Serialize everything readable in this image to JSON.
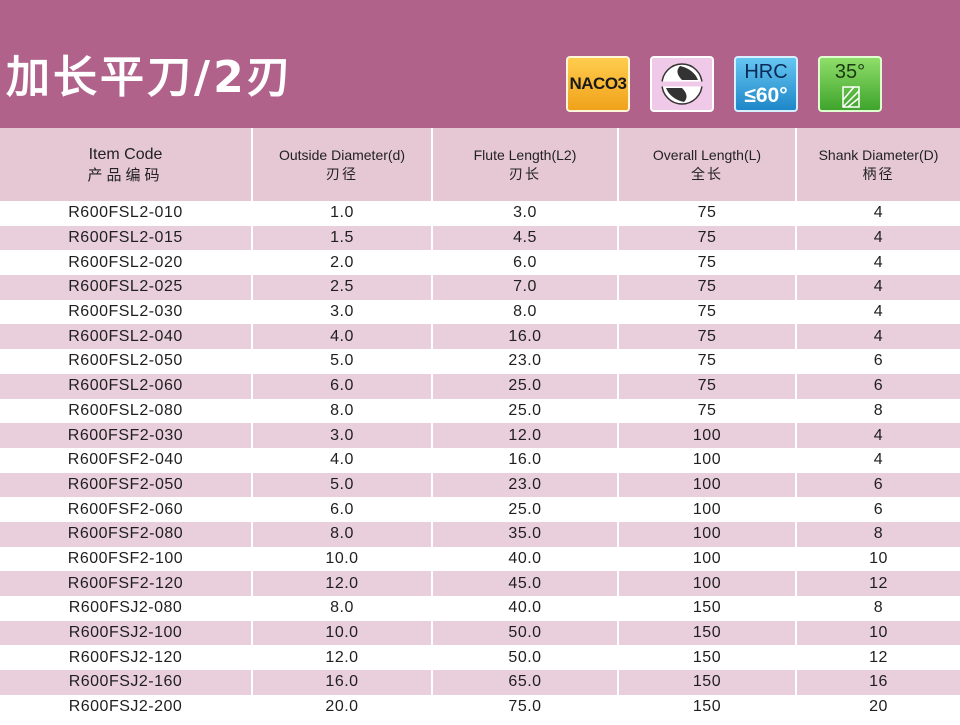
{
  "header": {
    "title": "加长平刀/2刃",
    "badges": {
      "material": "NACO3",
      "flute_icon": "two-flute-cross-section-icon",
      "hardness_line1": "HRC",
      "hardness_line2": "≤60°",
      "helix_angle": "35°",
      "helix_icon": "helix-angle-icon"
    },
    "colors": {
      "banner": "#b0628a",
      "header_row": "#e6c7d4",
      "stripe": "#e9cfdb"
    }
  },
  "table": {
    "columns": [
      {
        "en": "Item Code",
        "cn": "产品编码"
      },
      {
        "en": "Outside Diameter(d)",
        "cn": "刃径"
      },
      {
        "en": "Flute Length(L2)",
        "cn": "刃长"
      },
      {
        "en": "Overall Length(L)",
        "cn": "全长"
      },
      {
        "en": "Shank Diameter(D)",
        "cn": "柄径"
      }
    ],
    "rows": [
      [
        "R600FSL2-010",
        "1.0",
        "3.0",
        "75",
        "4"
      ],
      [
        "R600FSL2-015",
        "1.5",
        "4.5",
        "75",
        "4"
      ],
      [
        "R600FSL2-020",
        "2.0",
        "6.0",
        "75",
        "4"
      ],
      [
        "R600FSL2-025",
        "2.5",
        "7.0",
        "75",
        "4"
      ],
      [
        "R600FSL2-030",
        "3.0",
        "8.0",
        "75",
        "4"
      ],
      [
        "R600FSL2-040",
        "4.0",
        "16.0",
        "75",
        "4"
      ],
      [
        "R600FSL2-050",
        "5.0",
        "23.0",
        "75",
        "6"
      ],
      [
        "R600FSL2-060",
        "6.0",
        "25.0",
        "75",
        "6"
      ],
      [
        "R600FSL2-080",
        "8.0",
        "25.0",
        "75",
        "8"
      ],
      [
        "R600FSF2-030",
        "3.0",
        "12.0",
        "100",
        "4"
      ],
      [
        "R600FSF2-040",
        "4.0",
        "16.0",
        "100",
        "4"
      ],
      [
        "R600FSF2-050",
        "5.0",
        "23.0",
        "100",
        "6"
      ],
      [
        "R600FSF2-060",
        "6.0",
        "25.0",
        "100",
        "6"
      ],
      [
        "R600FSF2-080",
        "8.0",
        "35.0",
        "100",
        "8"
      ],
      [
        "R600FSF2-100",
        "10.0",
        "40.0",
        "100",
        "10"
      ],
      [
        "R600FSF2-120",
        "12.0",
        "45.0",
        "100",
        "12"
      ],
      [
        "R600FSJ2-080",
        "8.0",
        "40.0",
        "150",
        "8"
      ],
      [
        "R600FSJ2-100",
        "10.0",
        "50.0",
        "150",
        "10"
      ],
      [
        "R600FSJ2-120",
        "12.0",
        "50.0",
        "150",
        "12"
      ],
      [
        "R600FSJ2-160",
        "16.0",
        "65.0",
        "150",
        "16"
      ],
      [
        "R600FSJ2-200",
        "20.0",
        "75.0",
        "150",
        "20"
      ]
    ]
  }
}
